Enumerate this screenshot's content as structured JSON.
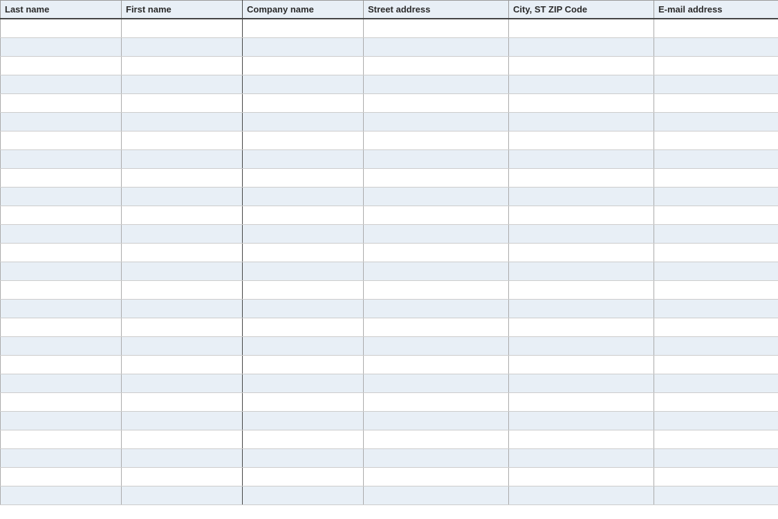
{
  "table": {
    "headers": {
      "last_name": "Last name",
      "first_name": "First name",
      "company_name": "Company name",
      "street_address": "Street address",
      "city_st_zip": "City, ST  ZIP Code",
      "email": "E-mail address"
    },
    "rows": [
      {
        "last_name": "",
        "first_name": "",
        "company_name": "",
        "street_address": "",
        "city_st_zip": "",
        "email": ""
      },
      {
        "last_name": "",
        "first_name": "",
        "company_name": "",
        "street_address": "",
        "city_st_zip": "",
        "email": ""
      },
      {
        "last_name": "",
        "first_name": "",
        "company_name": "",
        "street_address": "",
        "city_st_zip": "",
        "email": ""
      },
      {
        "last_name": "",
        "first_name": "",
        "company_name": "",
        "street_address": "",
        "city_st_zip": "",
        "email": ""
      },
      {
        "last_name": "",
        "first_name": "",
        "company_name": "",
        "street_address": "",
        "city_st_zip": "",
        "email": ""
      },
      {
        "last_name": "",
        "first_name": "",
        "company_name": "",
        "street_address": "",
        "city_st_zip": "",
        "email": ""
      },
      {
        "last_name": "",
        "first_name": "",
        "company_name": "",
        "street_address": "",
        "city_st_zip": "",
        "email": ""
      },
      {
        "last_name": "",
        "first_name": "",
        "company_name": "",
        "street_address": "",
        "city_st_zip": "",
        "email": ""
      },
      {
        "last_name": "",
        "first_name": "",
        "company_name": "",
        "street_address": "",
        "city_st_zip": "",
        "email": ""
      },
      {
        "last_name": "",
        "first_name": "",
        "company_name": "",
        "street_address": "",
        "city_st_zip": "",
        "email": ""
      },
      {
        "last_name": "",
        "first_name": "",
        "company_name": "",
        "street_address": "",
        "city_st_zip": "",
        "email": ""
      },
      {
        "last_name": "",
        "first_name": "",
        "company_name": "",
        "street_address": "",
        "city_st_zip": "",
        "email": ""
      },
      {
        "last_name": "",
        "first_name": "",
        "company_name": "",
        "street_address": "",
        "city_st_zip": "",
        "email": ""
      },
      {
        "last_name": "",
        "first_name": "",
        "company_name": "",
        "street_address": "",
        "city_st_zip": "",
        "email": ""
      },
      {
        "last_name": "",
        "first_name": "",
        "company_name": "",
        "street_address": "",
        "city_st_zip": "",
        "email": ""
      },
      {
        "last_name": "",
        "first_name": "",
        "company_name": "",
        "street_address": "",
        "city_st_zip": "",
        "email": ""
      },
      {
        "last_name": "",
        "first_name": "",
        "company_name": "",
        "street_address": "",
        "city_st_zip": "",
        "email": ""
      },
      {
        "last_name": "",
        "first_name": "",
        "company_name": "",
        "street_address": "",
        "city_st_zip": "",
        "email": ""
      },
      {
        "last_name": "",
        "first_name": "",
        "company_name": "",
        "street_address": "",
        "city_st_zip": "",
        "email": ""
      },
      {
        "last_name": "",
        "first_name": "",
        "company_name": "",
        "street_address": "",
        "city_st_zip": "",
        "email": ""
      },
      {
        "last_name": "",
        "first_name": "",
        "company_name": "",
        "street_address": "",
        "city_st_zip": "",
        "email": ""
      },
      {
        "last_name": "",
        "first_name": "",
        "company_name": "",
        "street_address": "",
        "city_st_zip": "",
        "email": ""
      },
      {
        "last_name": "",
        "first_name": "",
        "company_name": "",
        "street_address": "",
        "city_st_zip": "",
        "email": ""
      },
      {
        "last_name": "",
        "first_name": "",
        "company_name": "",
        "street_address": "",
        "city_st_zip": "",
        "email": ""
      },
      {
        "last_name": "",
        "first_name": "",
        "company_name": "",
        "street_address": "",
        "city_st_zip": "",
        "email": ""
      },
      {
        "last_name": "",
        "first_name": "",
        "company_name": "",
        "street_address": "",
        "city_st_zip": "",
        "email": ""
      }
    ]
  }
}
